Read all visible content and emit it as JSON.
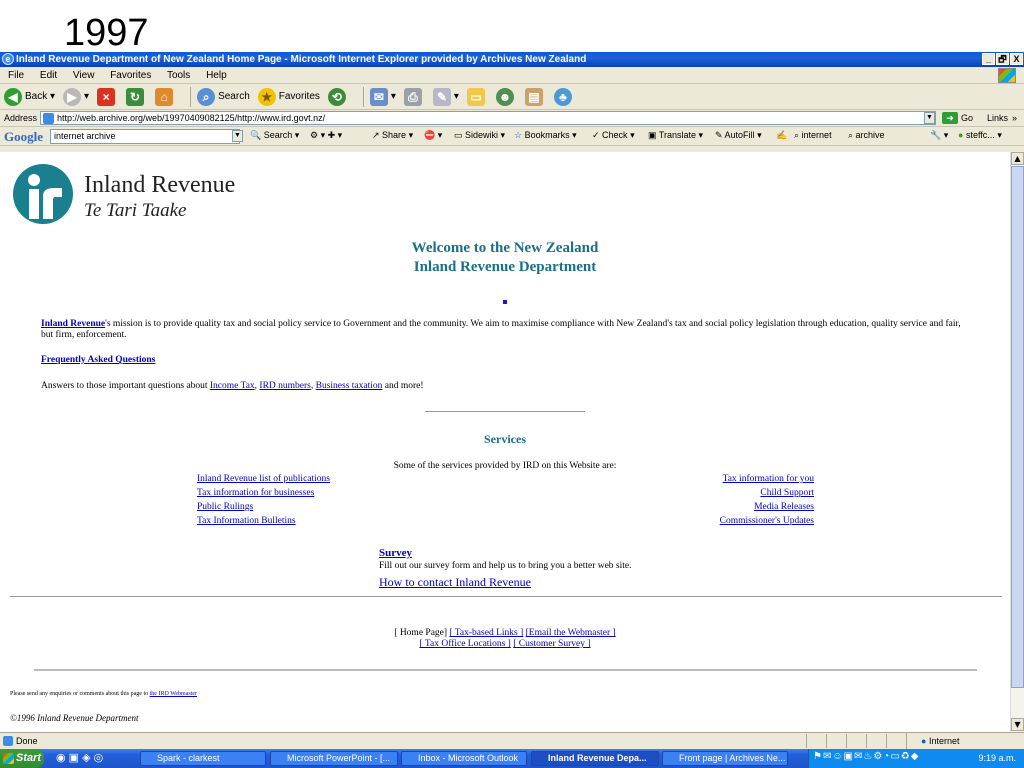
{
  "slide": {
    "title": "1997"
  },
  "window": {
    "title": "Inland Revenue Department of New Zealand Home Page - Microsoft Internet Explorer provided by Archives New Zealand",
    "controls": [
      "_",
      "🗗",
      "X"
    ]
  },
  "menu": [
    "File",
    "Edit",
    "View",
    "Favorites",
    "Tools",
    "Help"
  ],
  "toolbar": {
    "back": "Back",
    "search": "Search",
    "favorites": "Favorites"
  },
  "address": {
    "label": "Address",
    "url": "http://web.archive.org/web/19970409082125/http://www.ird.govt.nz/",
    "go": "Go",
    "links": "Links"
  },
  "googlebar": {
    "logo": "Google",
    "query": "internet archive",
    "items": [
      "Search",
      "Share",
      "Sidewiki",
      "Bookmarks",
      "Check",
      "Translate",
      "AutoFill",
      "internet",
      "archive",
      "steffc..."
    ]
  },
  "page": {
    "logo_title": "Inland Revenue",
    "logo_sub": "Te Tari Taake",
    "welcome_line1": "Welcome to the New Zealand",
    "welcome_line2": "Inland Revenue Department",
    "mission_link": "Inland Revenue",
    "mission_text": "'s mission is to provide quality tax and social policy service to Government and the community. We aim to maximise compliance with New Zealand's tax and social policy legislation through education, quality service and fair, but firm, enforcement.",
    "faq": "Frequently Asked Questions",
    "answers_prefix": "Answers to those important questions about",
    "answers_links": [
      "Income Tax",
      "IRD numbers",
      "Business taxation"
    ],
    "answers_suffix": "and more!",
    "services_title": "Services",
    "services_sub": "Some of the services provided by IRD on this Website are:",
    "services_left": [
      "Inland Revenue list of publications",
      "Tax information for businesses",
      "Public Rulings",
      "Tax Information Bulletins"
    ],
    "services_right": [
      "Tax information for you",
      "Child Support",
      "Media Releases",
      "Commissioner's Updates"
    ],
    "survey": "Survey",
    "survey_desc": "Fill out our survey form and help us to bring you a better web site.",
    "contact": "How to contact Inland Revenue",
    "footer_home": "[ Home Page]",
    "footer_links1": [
      "[ Tax-based Links ]",
      "[Email the Webmaster ]"
    ],
    "footer_links2": [
      "[ Tax Office Locations ]",
      "[ Customer Survey ]"
    ],
    "enquiries_text": "Please send any enquiries or comments about this page to",
    "enquiries_link": "the IRD Webmaster",
    "copyright": "©1996 Inland Revenue Department"
  },
  "status": {
    "text": "Done",
    "zone": "Internet"
  },
  "taskbar": {
    "start": "Start",
    "tasks": [
      "Spark - clarkest",
      "Microsoft PowerPoint - [...",
      "Inbox - Microsoft Outlook",
      "Inland Revenue Depa...",
      "Front page | Archives Ne..."
    ],
    "clock": "9:19 a.m."
  },
  "colors": {
    "heading": "#1a6f8a",
    "link": "#0000cc",
    "titlebar": "#0a5ad6",
    "logo": "#1a7f8e"
  }
}
